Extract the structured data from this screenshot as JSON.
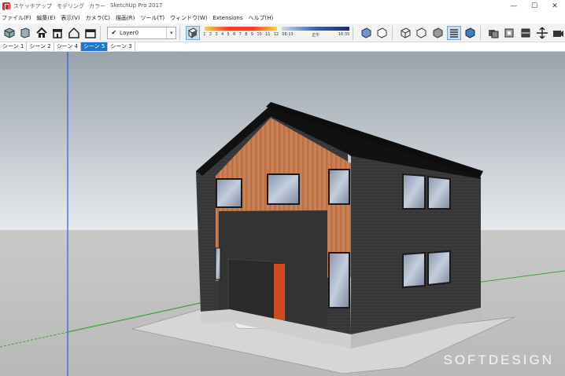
{
  "window": {
    "title_parts": [
      "スケッチアップ",
      "モデリング",
      "カラー",
      "SketchUp Pro 2017"
    ],
    "controls": [
      "—",
      "☐",
      "✕"
    ]
  },
  "menu": [
    "ファイル(F)",
    "編集(E)",
    "表示(V)",
    "カメラ(C)",
    "描画(R)",
    "ツール(T)",
    "ウィンドウ(W)",
    "Extensions",
    "ヘルプ(H)"
  ],
  "layer": {
    "current": "Layer0",
    "check": "✔",
    "arrow": "▾"
  },
  "shadow": {
    "months": [
      "1",
      "2",
      "3",
      "4",
      "5",
      "6",
      "7",
      "8",
      "9",
      "10",
      "11",
      "12"
    ],
    "time_start": "06:13",
    "noon": "正午",
    "time_end": "16:35"
  },
  "scenes": [
    {
      "label": "シーン 1",
      "active": false
    },
    {
      "label": "シーン 2",
      "active": false
    },
    {
      "label": "シーン 4",
      "active": false
    },
    {
      "label": "シーン 5",
      "active": true
    },
    {
      "label": "シーン 3",
      "active": false
    }
  ],
  "watermark": "SOFTDESIGN",
  "colors": {
    "sky_top": "#9aa3ac",
    "sky_bottom": "#e6eaed",
    "ground": "#c9c9c7",
    "wall_dark": "#3a3a3c",
    "wood": "#c57a4f",
    "door": "#d24a22",
    "roof": "#111111",
    "tab_active": "#1976d2"
  }
}
